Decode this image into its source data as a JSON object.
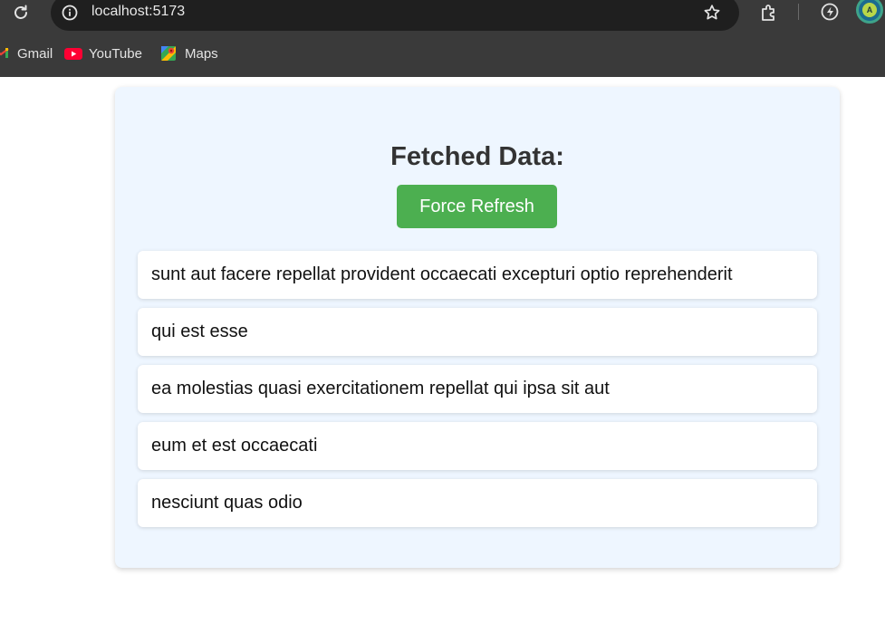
{
  "browser": {
    "url": "localhost:5173",
    "bookmarks": [
      {
        "label": "Gmail",
        "icon": "gmail-icon"
      },
      {
        "label": "YouTube",
        "icon": "youtube-icon"
      },
      {
        "label": "Maps",
        "icon": "maps-icon"
      }
    ],
    "profile_initial": "A"
  },
  "main": {
    "title": "Fetched Data:",
    "refresh_label": "Force Refresh",
    "accent_color": "#4caf50",
    "posts": [
      "sunt aut facere repellat provident occaecati excepturi optio reprehenderit",
      "qui est esse",
      "ea molestias quasi exercitationem repellat qui ipsa sit aut",
      "eum et est occaecati",
      "nesciunt quas odio"
    ]
  }
}
